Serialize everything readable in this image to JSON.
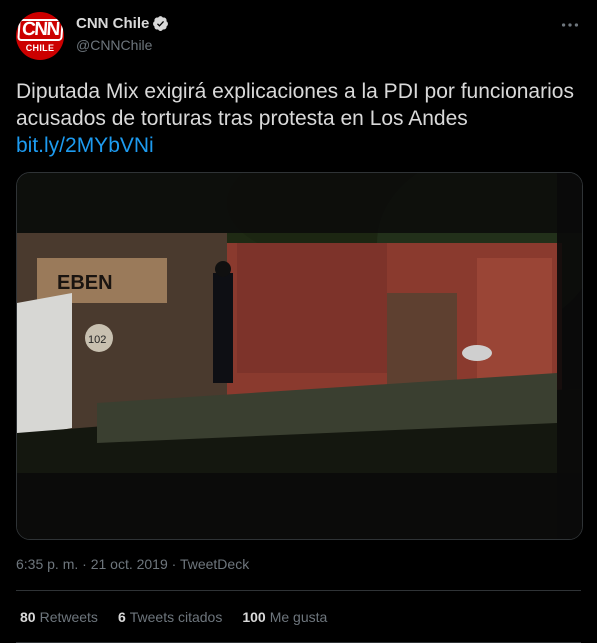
{
  "author": {
    "display_name": "CNN Chile",
    "handle": "@CNNChile",
    "avatar_text_top": "CNN",
    "avatar_text_bottom": "CHILE",
    "avatar_color": "#cc0000"
  },
  "tweet": {
    "text": "Diputada Mix exigirá explicaciones a la PDI por funcionarios acusados de torturas tras protesta en Los Andes",
    "link": "bit.ly/2MYbVNi",
    "link_color": "#1d9bf0",
    "media_icon": "video-still",
    "timestamp": "6:35 p. m. · 21 oct. 2019 · TweetDeck"
  },
  "stats": {
    "retweets_count": "80",
    "retweets_label": "Retweets",
    "quotes_count": "6",
    "quotes_label": "Tweets citados",
    "likes_count": "100",
    "likes_label": "Me gusta"
  },
  "media_text": {
    "banner": "EBEN",
    "house_number": "102"
  },
  "icons": {
    "verified": "verified-badge-icon",
    "more": "more-options-icon"
  }
}
